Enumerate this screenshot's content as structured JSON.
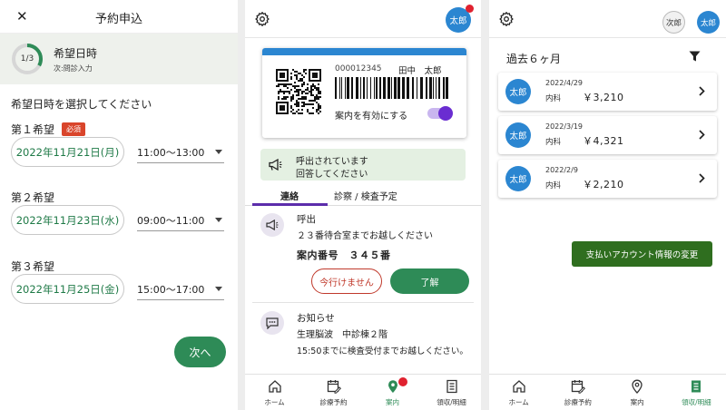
{
  "colors": {
    "accent": "#2e8b57",
    "avatar": "#2b86d1",
    "required": "#d9452b",
    "notify": "#e0212f",
    "tab": "#5c2dab"
  },
  "screen1": {
    "title": "予約申込",
    "step": {
      "text": "1/3",
      "progress": 0.33,
      "title": "希望日時",
      "subtitle": "次:問診入力"
    },
    "instruction": "希望日時を選択してください",
    "required_badge": "必須",
    "preferences": [
      {
        "label": "第１希望",
        "date": "2022年11月21日(月)",
        "time": "11:00～13:00"
      },
      {
        "label": "第２希望",
        "date": "2022年11月23日(水)",
        "time": "09:00～11:00"
      },
      {
        "label": "第３希望",
        "date": "2022年11月25日(金)",
        "time": "15:00～17:00"
      }
    ],
    "next_button": "次へ"
  },
  "screen2": {
    "avatar": "太郎",
    "card": {
      "id": "000012345",
      "name": "田中　太郎",
      "toggle_label": "案内を有効にする"
    },
    "call": {
      "line1": "呼出されています",
      "line2": "回答してください"
    },
    "tabs": [
      "連絡",
      "診察 / 検査予定"
    ],
    "message1": {
      "title": "呼出",
      "body": "２３番待合室までお越しください",
      "guide": "案内番号　３４５番"
    },
    "decline_button": "今行けません",
    "ok_button": "了解",
    "message2": {
      "title": "お知らせ",
      "line1": "生理脳波　中診棟２階",
      "line2": "15:50までに検査受付までお越しください。"
    }
  },
  "screen3": {
    "avatar_secondary": "次郎",
    "avatar_primary": "太郎",
    "history_title": "過去６ヶ月",
    "items": [
      {
        "avatar": "太郎",
        "date": "2022/4/29",
        "dept": "内科",
        "amount": "￥3,210"
      },
      {
        "avatar": "太郎",
        "date": "2022/3/19",
        "dept": "内科",
        "amount": "￥4,321"
      },
      {
        "avatar": "太郎",
        "date": "2022/2/9",
        "dept": "内科",
        "amount": "￥2,210"
      }
    ],
    "pay_button": "支払いアカウント情報の変更"
  },
  "nav": [
    "ホーム",
    "診療予約",
    "案内",
    "領収/明細"
  ]
}
